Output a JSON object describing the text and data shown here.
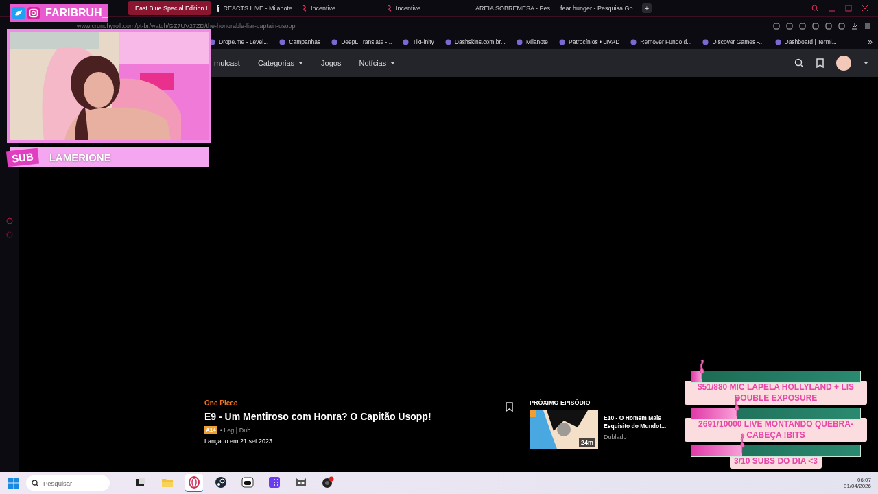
{
  "browser": {
    "tabs": [
      {
        "label": "East Blue Special Edition I",
        "kind": "crunchyroll",
        "selected": true
      },
      {
        "label": "REACTS LIVE - Milanote",
        "kind": "milanote",
        "selected": false
      },
      {
        "label": "Incentive",
        "kind": "incentive",
        "selected": false
      },
      {
        "label": "Incentive",
        "kind": "incentive",
        "selected": false
      },
      {
        "label": "AREIA SOBREMESA - Pes",
        "kind": "google",
        "selected": false
      },
      {
        "label": "fear hunger - Pesquisa Go",
        "kind": "google",
        "selected": false
      }
    ],
    "new_tab": "+",
    "address_bar": {
      "url": "www.crunchyroll.com/pt-br/watch/GZ7UV27ZD/the-honorable-liar-captain-usopp"
    },
    "bookmarks": [
      "Drope.me - Level...",
      "Campanhas",
      "DeepL Translate -...",
      "TikFinity",
      "Dashskins.com.br...",
      "Milanote",
      "Patrocínios • LIVAD",
      "Remover Fundo d...",
      "Discover Games -...",
      "Dashboard | Termi..."
    ],
    "bookmarks_more": "»",
    "site_nav": [
      {
        "label": "mulcast",
        "dropdown": false
      },
      {
        "label": "Categorias",
        "dropdown": true
      },
      {
        "label": "Jogos",
        "dropdown": false
      },
      {
        "label": "Notícias",
        "dropdown": true
      }
    ],
    "episode": {
      "series": "One Piece",
      "title": "E9 - Um Mentiroso com Honra? O Capitão Usopp!",
      "rating": "A14",
      "audio": "• Leg | Dub",
      "released": "Lançado em 21 set 2023"
    },
    "next_episode": {
      "heading": "PRÓXIMO EPISÓDIO",
      "title": "E10 - O Homem Mais Esquisito do Mundo!...",
      "duration": "24m",
      "audio": "Dublado"
    }
  },
  "stream_overlay": {
    "social_handle": "FARIBRUH_",
    "sub_alert": {
      "badge": "SUB",
      "name": "LAMERIONE"
    },
    "goals": [
      {
        "text": "$51/880 MIC LAPELA HOLLYLAND + LIS DOUBLE EXPOSURE",
        "level": 0.06
      },
      {
        "text": "2691/10000 LIVE MONTANDO QUEBRA-CABEÇA !BITS",
        "level": 0.27
      },
      {
        "text": "3/10 SUBS DO DIA <3",
        "level": 0.3
      }
    ]
  },
  "taskbar": {
    "search_placeholder": "Pesquisar",
    "apps": [
      {
        "kind": "taskview",
        "active": false
      },
      {
        "kind": "folder",
        "active": false
      },
      {
        "kind": "opera",
        "active": true
      },
      {
        "kind": "steam",
        "active": false
      },
      {
        "kind": "bot",
        "active": false
      },
      {
        "kind": "grid",
        "active": false
      },
      {
        "kind": "cat",
        "active": false
      },
      {
        "kind": "obs",
        "active": false
      }
    ],
    "time": "06:07",
    "date": "01/04/2026"
  }
}
